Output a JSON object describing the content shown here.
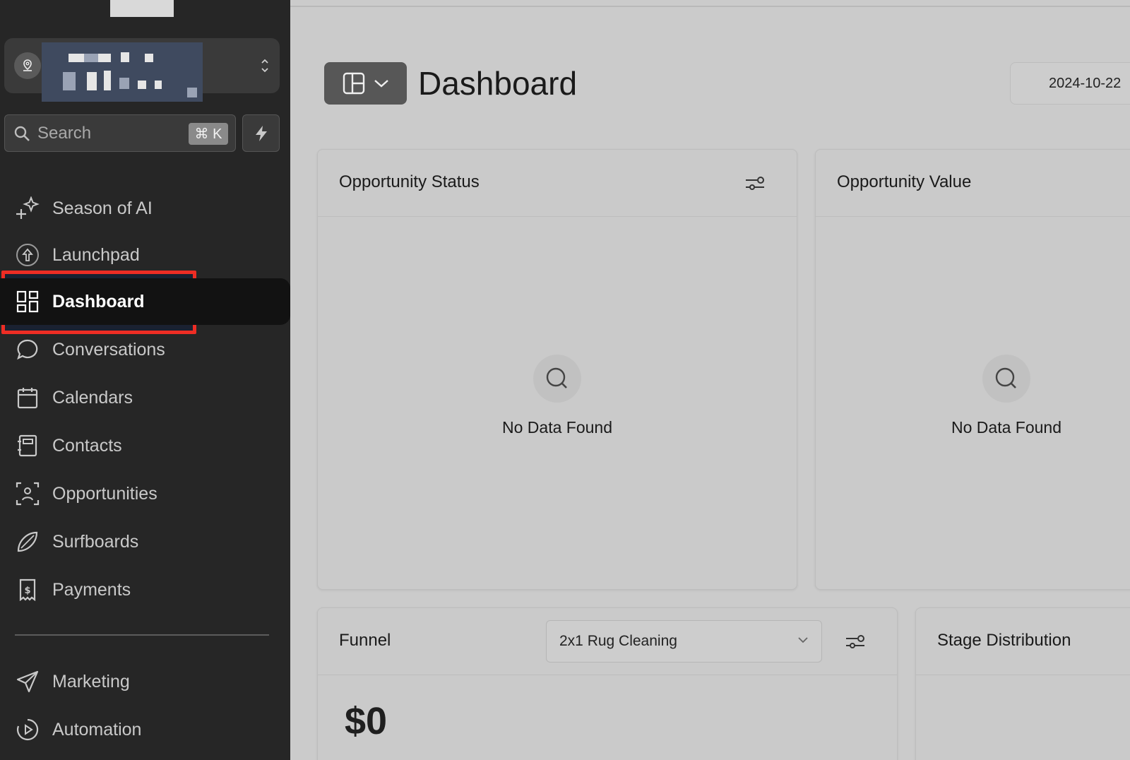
{
  "sidebar": {
    "search": {
      "placeholder": "Search",
      "shortcut": "⌘ K"
    },
    "items": [
      {
        "label": "Season of AI",
        "icon": "sparkle-icon"
      },
      {
        "label": "Launchpad",
        "icon": "launchpad-icon"
      },
      {
        "label": "Dashboard",
        "icon": "dashboard-grid-icon",
        "active": true
      },
      {
        "label": "Conversations",
        "icon": "chat-bubble-icon"
      },
      {
        "label": "Calendars",
        "icon": "calendar-icon"
      },
      {
        "label": "Contacts",
        "icon": "contacts-book-icon"
      },
      {
        "label": "Opportunities",
        "icon": "opportunities-icon"
      },
      {
        "label": "Surfboards",
        "icon": "surfboard-icon"
      },
      {
        "label": "Payments",
        "icon": "payments-icon"
      },
      {
        "label": "Marketing",
        "icon": "send-icon"
      },
      {
        "label": "Automation",
        "icon": "automation-icon"
      }
    ]
  },
  "header": {
    "title": "Dashboard",
    "date": "2024-10-22"
  },
  "cards": {
    "opportunity_status": {
      "title": "Opportunity Status",
      "empty": "No Data Found"
    },
    "opportunity_value": {
      "title": "Opportunity Value",
      "empty": "No Data Found"
    },
    "funnel": {
      "title": "Funnel",
      "selected_pipeline": "2x1 Rug Cleaning",
      "value": "$0"
    },
    "stage_distribution": {
      "title": "Stage Distribution"
    }
  },
  "colors": {
    "sidebar_bg": "#262626",
    "highlight_border": "#ee2d24",
    "main_bg": "#cbcbcb"
  }
}
